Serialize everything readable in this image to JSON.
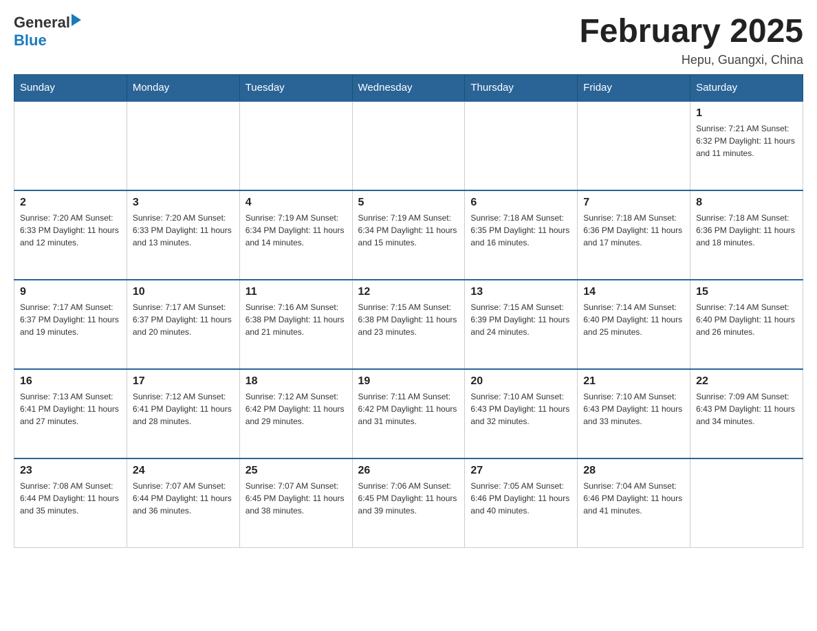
{
  "header": {
    "logo_general": "General",
    "logo_blue": "Blue",
    "month_title": "February 2025",
    "location": "Hepu, Guangxi, China"
  },
  "days_of_week": [
    "Sunday",
    "Monday",
    "Tuesday",
    "Wednesday",
    "Thursday",
    "Friday",
    "Saturday"
  ],
  "weeks": [
    [
      {
        "day": "",
        "info": ""
      },
      {
        "day": "",
        "info": ""
      },
      {
        "day": "",
        "info": ""
      },
      {
        "day": "",
        "info": ""
      },
      {
        "day": "",
        "info": ""
      },
      {
        "day": "",
        "info": ""
      },
      {
        "day": "1",
        "info": "Sunrise: 7:21 AM\nSunset: 6:32 PM\nDaylight: 11 hours and 11 minutes."
      }
    ],
    [
      {
        "day": "2",
        "info": "Sunrise: 7:20 AM\nSunset: 6:33 PM\nDaylight: 11 hours and 12 minutes."
      },
      {
        "day": "3",
        "info": "Sunrise: 7:20 AM\nSunset: 6:33 PM\nDaylight: 11 hours and 13 minutes."
      },
      {
        "day": "4",
        "info": "Sunrise: 7:19 AM\nSunset: 6:34 PM\nDaylight: 11 hours and 14 minutes."
      },
      {
        "day": "5",
        "info": "Sunrise: 7:19 AM\nSunset: 6:34 PM\nDaylight: 11 hours and 15 minutes."
      },
      {
        "day": "6",
        "info": "Sunrise: 7:18 AM\nSunset: 6:35 PM\nDaylight: 11 hours and 16 minutes."
      },
      {
        "day": "7",
        "info": "Sunrise: 7:18 AM\nSunset: 6:36 PM\nDaylight: 11 hours and 17 minutes."
      },
      {
        "day": "8",
        "info": "Sunrise: 7:18 AM\nSunset: 6:36 PM\nDaylight: 11 hours and 18 minutes."
      }
    ],
    [
      {
        "day": "9",
        "info": "Sunrise: 7:17 AM\nSunset: 6:37 PM\nDaylight: 11 hours and 19 minutes."
      },
      {
        "day": "10",
        "info": "Sunrise: 7:17 AM\nSunset: 6:37 PM\nDaylight: 11 hours and 20 minutes."
      },
      {
        "day": "11",
        "info": "Sunrise: 7:16 AM\nSunset: 6:38 PM\nDaylight: 11 hours and 21 minutes."
      },
      {
        "day": "12",
        "info": "Sunrise: 7:15 AM\nSunset: 6:38 PM\nDaylight: 11 hours and 23 minutes."
      },
      {
        "day": "13",
        "info": "Sunrise: 7:15 AM\nSunset: 6:39 PM\nDaylight: 11 hours and 24 minutes."
      },
      {
        "day": "14",
        "info": "Sunrise: 7:14 AM\nSunset: 6:40 PM\nDaylight: 11 hours and 25 minutes."
      },
      {
        "day": "15",
        "info": "Sunrise: 7:14 AM\nSunset: 6:40 PM\nDaylight: 11 hours and 26 minutes."
      }
    ],
    [
      {
        "day": "16",
        "info": "Sunrise: 7:13 AM\nSunset: 6:41 PM\nDaylight: 11 hours and 27 minutes."
      },
      {
        "day": "17",
        "info": "Sunrise: 7:12 AM\nSunset: 6:41 PM\nDaylight: 11 hours and 28 minutes."
      },
      {
        "day": "18",
        "info": "Sunrise: 7:12 AM\nSunset: 6:42 PM\nDaylight: 11 hours and 29 minutes."
      },
      {
        "day": "19",
        "info": "Sunrise: 7:11 AM\nSunset: 6:42 PM\nDaylight: 11 hours and 31 minutes."
      },
      {
        "day": "20",
        "info": "Sunrise: 7:10 AM\nSunset: 6:43 PM\nDaylight: 11 hours and 32 minutes."
      },
      {
        "day": "21",
        "info": "Sunrise: 7:10 AM\nSunset: 6:43 PM\nDaylight: 11 hours and 33 minutes."
      },
      {
        "day": "22",
        "info": "Sunrise: 7:09 AM\nSunset: 6:43 PM\nDaylight: 11 hours and 34 minutes."
      }
    ],
    [
      {
        "day": "23",
        "info": "Sunrise: 7:08 AM\nSunset: 6:44 PM\nDaylight: 11 hours and 35 minutes."
      },
      {
        "day": "24",
        "info": "Sunrise: 7:07 AM\nSunset: 6:44 PM\nDaylight: 11 hours and 36 minutes."
      },
      {
        "day": "25",
        "info": "Sunrise: 7:07 AM\nSunset: 6:45 PM\nDaylight: 11 hours and 38 minutes."
      },
      {
        "day": "26",
        "info": "Sunrise: 7:06 AM\nSunset: 6:45 PM\nDaylight: 11 hours and 39 minutes."
      },
      {
        "day": "27",
        "info": "Sunrise: 7:05 AM\nSunset: 6:46 PM\nDaylight: 11 hours and 40 minutes."
      },
      {
        "day": "28",
        "info": "Sunrise: 7:04 AM\nSunset: 6:46 PM\nDaylight: 11 hours and 41 minutes."
      },
      {
        "day": "",
        "info": ""
      }
    ]
  ]
}
